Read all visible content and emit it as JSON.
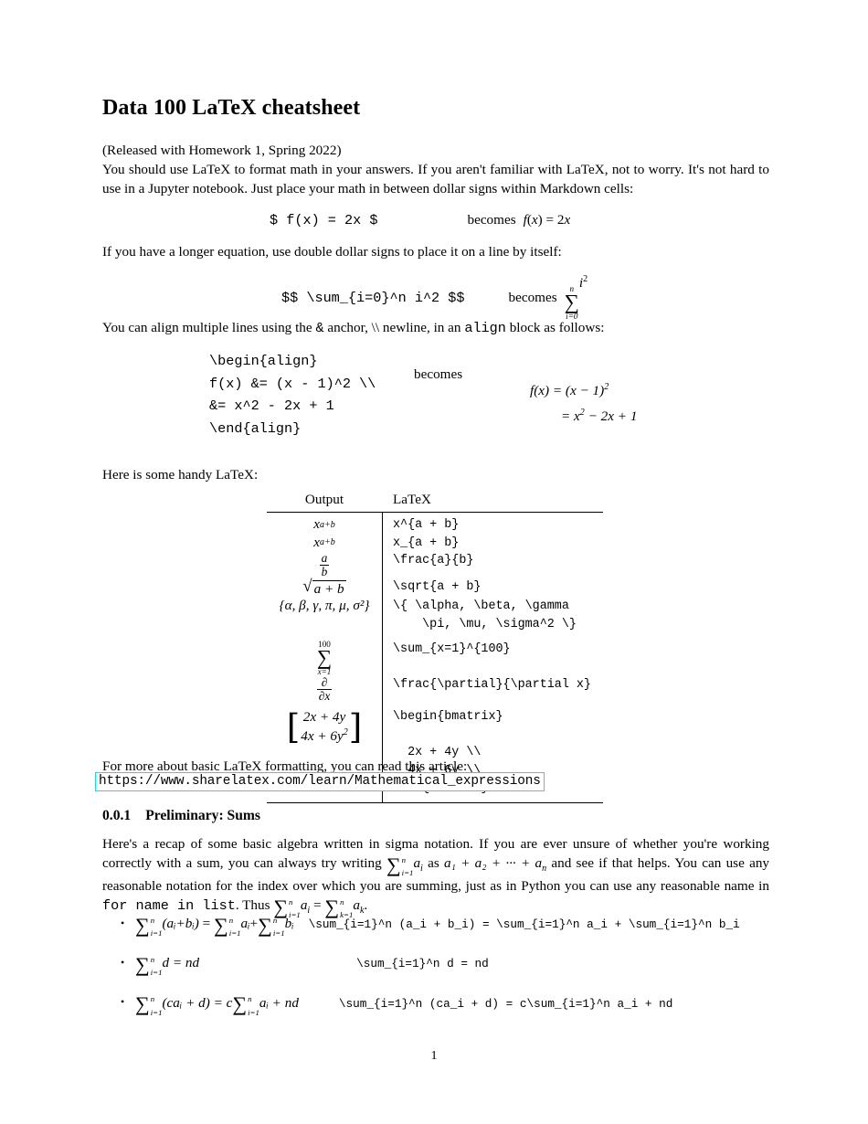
{
  "document": {
    "title": "Data 100 LaTeX cheatsheet",
    "release_note": "(Released with Homework 1, Spring 2022)",
    "intro_paragraph": "You should use LaTeX to format math in your answers. If you aren't familiar with LaTeX, not to worry. It's not hard to use in a Jupyter notebook. Just place your math in between dollar signs within Markdown cells:",
    "page_number": "1"
  },
  "examples": {
    "becomes_label": "becomes",
    "inline": {
      "code": "$ f(x) = 2x $",
      "output_lhs": "f",
      "output_paren_open": "(",
      "output_var": "x",
      "output_paren_close": ")",
      "output_eq": "= 2",
      "output_var2": "x"
    },
    "display_intro": "If you have a longer equation, use double dollar signs to place it on a line by itself:",
    "display": {
      "code": "$$ \\sum_{i=0}^n i^2 $$",
      "sum_upper": "n",
      "sum_lower": "i=0",
      "sum_body_base": "i",
      "sum_body_exp": "2"
    },
    "align_intro_1": "You can align multiple lines using the ",
    "align_intro_amp": "&",
    "align_intro_2": " anchor, \\\\ newline, in an ",
    "align_intro_code": "align",
    "align_intro_3": " block as follows:",
    "align": {
      "code_lines": [
        "\\begin{align}",
        "f(x) &= (x - 1)^2 \\\\",
        "&= x^2 - 2x + 1",
        "\\end{align}"
      ],
      "output_line1": "f(x) = (x − 1)",
      "output_line1_exp": "2",
      "output_line2_pre": "= x",
      "output_line2_exp": "2",
      "output_line2_post": " − 2x + 1"
    }
  },
  "handy_intro": "Here is some handy LaTeX:",
  "table": {
    "headers": [
      "Output",
      "LaTeX"
    ],
    "rows": [
      {
        "output_kind": "sup",
        "base": "x",
        "script": "a+b",
        "latex": "x^{a + b}"
      },
      {
        "output_kind": "sub",
        "base": "x",
        "script": "a+b",
        "latex": "x_{a + b}"
      },
      {
        "output_kind": "frac",
        "num": "a",
        "den": "b",
        "latex": "\\frac{a}{b}"
      },
      {
        "output_kind": "sqrt",
        "body": "a + b",
        "latex": "\\sqrt{a + b}"
      },
      {
        "output_kind": "set",
        "body": "{α, β, γ, π, μ, σ²}",
        "latex": "\\{ \\alpha, \\beta, \\gamma\n    \\pi, \\mu, \\sigma^2 \\}"
      },
      {
        "output_kind": "sum",
        "upper": "100",
        "lower": "x=1",
        "latex": "\\sum_{x=1}^{100}"
      },
      {
        "output_kind": "partial",
        "num": "∂",
        "den": "∂x",
        "latex": "\\frac{\\partial}{\\partial x}"
      },
      {
        "output_kind": "matrix",
        "row1": "2x + 4y",
        "row2_pre": "4x + 6y",
        "row2_exp": "2",
        "latex": "\\begin{bmatrix}\n\n  2x + 4y \\\\\n  4x + 6y \\\\\n\\end{bmatrix}"
      }
    ]
  },
  "article": {
    "lead_in": "For more about basic LaTeX formatting, you can read this article:",
    "url": "https://www.sharelatex.com/learn/Mathematical_expressions",
    "border_color": "#00e8e8"
  },
  "section": {
    "number": "0.0.1",
    "heading": "Preliminary: Sums",
    "paragraph_1": "Here's a recap of some basic algebra written in sigma notation. If you are ever unsure of whether you're working correctly with a sum, you can always try writing ",
    "sum_ai": "∑",
    "sum_lower": "i=1",
    "sum_upper": "n",
    "a_i": "a",
    "a_i_sub": "i",
    "paragraph_2": " as ",
    "expansion": "a₁ + a₂ + ··· + a",
    "expansion_sub": "n",
    "paragraph_3": " and see if that helps. You can use any reasonable notation for the index over which you are summing, just as in Python you can use any reasonable name in ",
    "code_inline": "for name in list",
    "paragraph_4": ". Thus ",
    "identity_lhs_sub": "i=1",
    "identity_rhs_sub": "k=1",
    "identity_a": "a",
    "identity_a_sub": "i",
    "identity_b": "a",
    "identity_b_sub": "k",
    "paragraph_5": "."
  },
  "bullets": [
    {
      "id": "sum-of-sums",
      "bullet_glyph": "•",
      "latex": "\\sum_{i=1}^n (a_i + b_i) = \\sum_{i=1}^n a_i + \\sum_{i=1}^n b_i",
      "math": {
        "lhs_paren": "(aᵢ+bᵢ)",
        "eq": "=",
        "rhs_a": "aᵢ",
        "plus": "+",
        "rhs_b": "bᵢ",
        "upper": "n",
        "lower": "i=1"
      }
    },
    {
      "id": "sum-of-constant",
      "bullet_glyph": "•",
      "latex": "\\sum_{i=1}^n d = nd",
      "math": {
        "body": "d",
        "eq": "= nd",
        "upper": "n",
        "lower": "i=1"
      }
    },
    {
      "id": "linearity",
      "bullet_glyph": "•",
      "latex": "\\sum_{i=1}^n (ca_i + d) = c\\sum_{i=1}^n a_i + nd",
      "math": {
        "body": "(caᵢ + d)",
        "eq": "= c",
        "rhs": "aᵢ + nd",
        "upper": "n",
        "lower": "i=1"
      }
    }
  ]
}
